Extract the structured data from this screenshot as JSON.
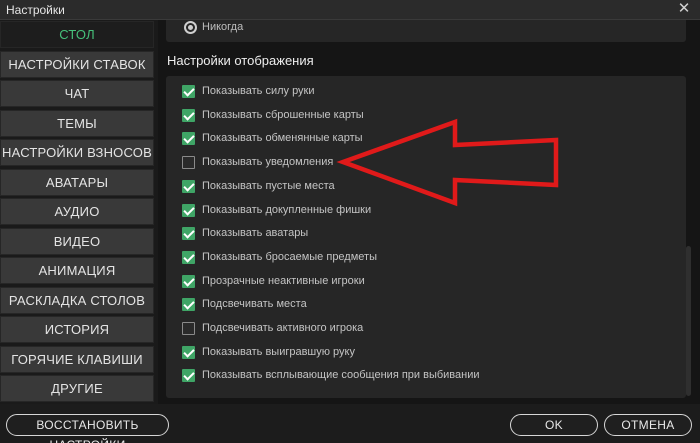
{
  "window": {
    "title": "Настройки",
    "close_glyph": "✕"
  },
  "sidebar": {
    "items": [
      {
        "label": "СТОЛ",
        "active": true
      },
      {
        "label": "НАСТРОЙКИ СТАВОК",
        "active": false
      },
      {
        "label": "ЧАТ",
        "active": false
      },
      {
        "label": "ТЕМЫ",
        "active": false
      },
      {
        "label": "НАСТРОЙКИ ВЗНОСОВ",
        "active": false
      },
      {
        "label": "АВАТАРЫ",
        "active": false
      },
      {
        "label": "АУДИО",
        "active": false
      },
      {
        "label": "ВИДЕО",
        "active": false
      },
      {
        "label": "АНИМАЦИЯ",
        "active": false
      },
      {
        "label": "РАСКЛАДКА СТОЛОВ",
        "active": false
      },
      {
        "label": "ИСТОРИЯ",
        "active": false
      },
      {
        "label": "ГОРЯЧИЕ КЛАВИШИ",
        "active": false
      },
      {
        "label": "ДРУГИЕ",
        "active": false
      }
    ]
  },
  "top_option": {
    "label": "Никогда",
    "selected": true
  },
  "display_settings": {
    "title": "Настройки отображения",
    "options": [
      {
        "label": "Показывать силу руки",
        "checked": true
      },
      {
        "label": "Показывать сброшенные карты",
        "checked": true
      },
      {
        "label": "Показывать обменянные карты",
        "checked": true
      },
      {
        "label": "Показывать уведомления",
        "checked": false
      },
      {
        "label": "Показывать пустые места",
        "checked": true
      },
      {
        "label": "Показывать докупленные фишки",
        "checked": true
      },
      {
        "label": "Показывать аватары",
        "checked": true
      },
      {
        "label": "Показывать бросаемые предметы",
        "checked": true
      },
      {
        "label": "Прозрачные неактивные игроки",
        "checked": true
      },
      {
        "label": "Подсвечивать места",
        "checked": true
      },
      {
        "label": "Подсвечивать активного игрока",
        "checked": false
      },
      {
        "label": "Показывать выигравшую руку",
        "checked": true
      },
      {
        "label": "Показывать всплывающие сообщения при выбивании",
        "checked": true
      }
    ]
  },
  "footer": {
    "restore_label": "ВОССТАНОВИТЬ НАСТРОЙКИ",
    "ok_label": "OK",
    "cancel_label": "ОТМЕНА"
  },
  "colors": {
    "accent": "#46c07a",
    "checkbox": "#3fa566",
    "annotation_arrow": "#e01a1a"
  }
}
